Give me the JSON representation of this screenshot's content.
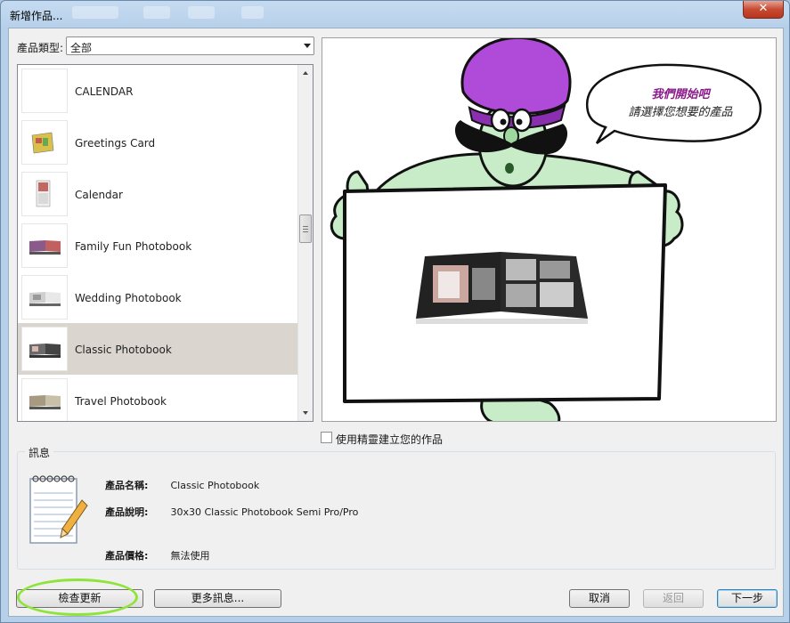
{
  "window": {
    "title": "新增作品..."
  },
  "product_type": {
    "label": "產品類型:",
    "selected": "全部"
  },
  "products": [
    {
      "label": "CALENDAR",
      "icon": "blank-thumbnail-icon"
    },
    {
      "label": "Greetings Card",
      "icon": "greeting-card-thumbnail-icon"
    },
    {
      "label": "Calendar",
      "icon": "calendar-thumbnail-icon"
    },
    {
      "label": "Family Fun Photobook",
      "icon": "photobook-thumbnail-icon"
    },
    {
      "label": "Wedding Photobook",
      "icon": "photobook-thumbnail-icon"
    },
    {
      "label": "Classic Photobook",
      "icon": "photobook-thumbnail-icon",
      "selected": true
    },
    {
      "label": "Travel Photobook",
      "icon": "photobook-thumbnail-icon"
    }
  ],
  "preview": {
    "bubble_title": "我們開始吧",
    "bubble_text": "請選擇您想要的產品"
  },
  "wizard": {
    "label": "使用精靈建立您的作品",
    "checked": false
  },
  "info": {
    "legend": "訊息",
    "name_key": "產品名稱:",
    "name_value": "Classic Photobook",
    "desc_key": "產品說明:",
    "desc_value": "30x30 Classic Photobook Semi Pro/Pro",
    "price_key": "產品價格:",
    "price_value": "無法使用"
  },
  "buttons": {
    "check_update": "檢查更新",
    "more_info": "更多訊息...",
    "cancel": "取消",
    "back": "返回",
    "next": "下一步"
  },
  "colors": {
    "selected_row": "#dad6cf",
    "highlight": "#8fe43a",
    "turban": "#b04ad8",
    "genie": "#c8ecc8"
  }
}
